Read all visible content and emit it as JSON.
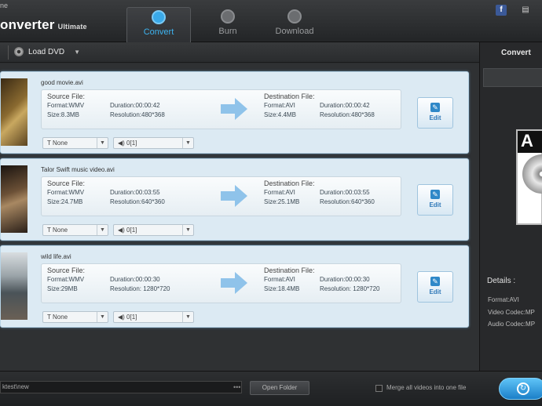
{
  "app": {
    "brand_small": "ne",
    "brand_name": "onverter",
    "brand_edition": "Ultimate"
  },
  "main_tabs": [
    {
      "label": "Convert",
      "active": true,
      "icon": "refresh-icon"
    },
    {
      "label": "Burn",
      "active": false,
      "icon": "disc-icon"
    },
    {
      "label": "Download",
      "active": false,
      "icon": "download-icon"
    }
  ],
  "toolbar": {
    "load_dvd_label": "Load DVD",
    "load_dvd_arrow": "▼"
  },
  "files": [
    {
      "name": "good movie.avi",
      "source": {
        "header": "Source File:",
        "format": "Format:WMV",
        "size": "Size:8.3MB",
        "duration": "Duration:00:00:42",
        "resolution": "Resolution:480*368"
      },
      "destination": {
        "header": "Destination File:",
        "format": "Format:AVI",
        "size": "Size:4.4MB",
        "duration": "Duration:00:00:42",
        "resolution": "Resolution:480*368"
      },
      "edit_label": "Edit",
      "subtitle": "None",
      "audio": "0[1]"
    },
    {
      "name": "Talor Swift music video.avi",
      "source": {
        "header": "Source File:",
        "format": "Format:WMV",
        "size": "Size:24.7MB",
        "duration": "Duration:00:03:55",
        "resolution": "Resolution:640*360"
      },
      "destination": {
        "header": "Destination File:",
        "format": "Format:AVI",
        "size": "Size:25.1MB",
        "duration": "Duration:00:03:55",
        "resolution": "Resolution:640*360"
      },
      "edit_label": "Edit",
      "subtitle": "None",
      "audio": "0[1]"
    },
    {
      "name": "wild life.avi",
      "source": {
        "header": "Source File:",
        "format": "Format:WMV",
        "size": "Size:29MB",
        "duration": "Duration:00:00:30",
        "resolution": "Resolution: 1280*720"
      },
      "destination": {
        "header": "Destination File:",
        "format": "Format:AVI",
        "size": "Size:18.4MB",
        "duration": "Duration:00:00:30",
        "resolution": "Resolution: 1280*720"
      },
      "edit_label": "Edit",
      "subtitle": "None",
      "audio": "0[1]"
    }
  ],
  "right_panel": {
    "title": "Convert",
    "preview_text": "A",
    "details_label": "Details :",
    "format": "Format:AVI",
    "video_codec": "Video Codec:MP",
    "audio_codec": "Audio Codec:MP"
  },
  "bottom": {
    "output_path": "ktest\\new",
    "path_more": "•••",
    "open_folder": "Open Folder",
    "merge_label": "Merge all videos into one file"
  },
  "colors": {
    "accent": "#3db3f0",
    "item_bg": "#dceaf3",
    "convert_button": "#1b7fc8"
  }
}
